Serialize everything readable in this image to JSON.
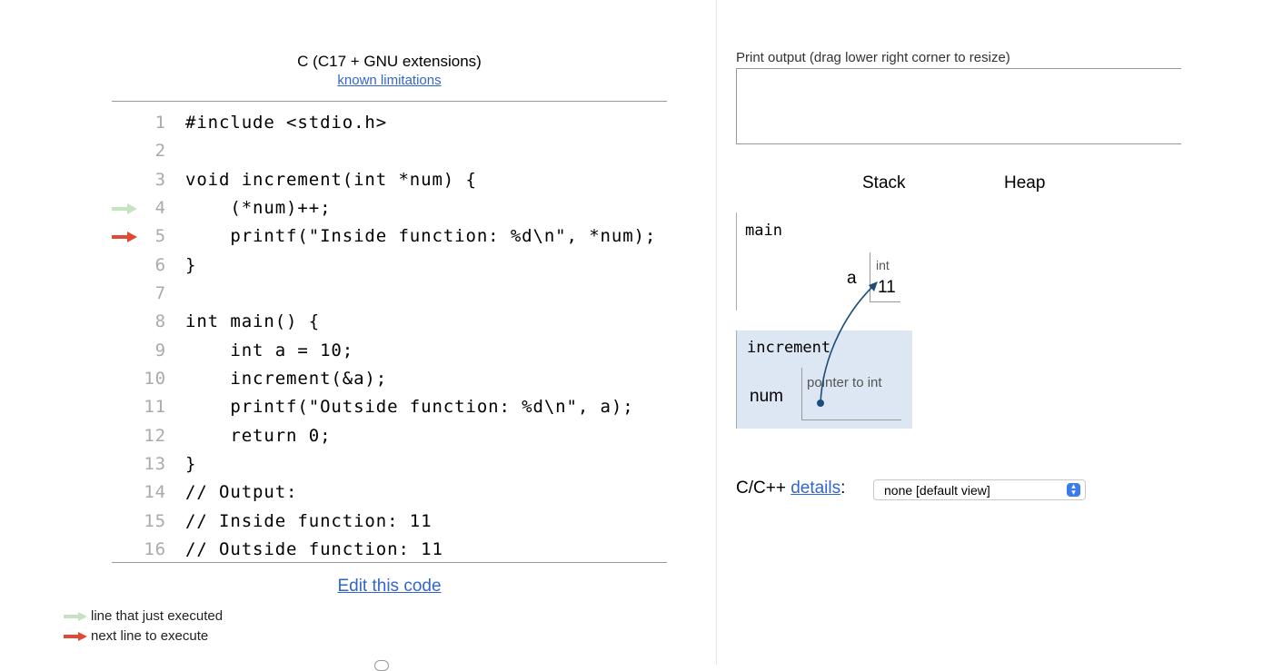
{
  "header": {
    "language": "C (C17 + GNU extensions)",
    "limitations_link": "known limitations"
  },
  "code_lines": [
    {
      "num": "1",
      "text": "#include <stdio.h>",
      "marker": ""
    },
    {
      "num": "2",
      "text": "",
      "marker": ""
    },
    {
      "num": "3",
      "text": "void increment(int *num) {",
      "marker": ""
    },
    {
      "num": "4",
      "text": "    (*num)++;",
      "marker": "just-executed"
    },
    {
      "num": "5",
      "text": "    printf(\"Inside function: %d\\n\", *num);",
      "marker": "next"
    },
    {
      "num": "6",
      "text": "}",
      "marker": ""
    },
    {
      "num": "7",
      "text": "",
      "marker": ""
    },
    {
      "num": "8",
      "text": "int main() {",
      "marker": ""
    },
    {
      "num": "9",
      "text": "    int a = 10;",
      "marker": ""
    },
    {
      "num": "10",
      "text": "    increment(&a);",
      "marker": ""
    },
    {
      "num": "11",
      "text": "    printf(\"Outside function: %d\\n\", a);",
      "marker": ""
    },
    {
      "num": "12",
      "text": "    return 0;",
      "marker": ""
    },
    {
      "num": "13",
      "text": "}",
      "marker": ""
    },
    {
      "num": "14",
      "text": "// Output:",
      "marker": ""
    },
    {
      "num": "15",
      "text": "// Inside function: 11",
      "marker": ""
    },
    {
      "num": "16",
      "text": "// Outside function: 11",
      "marker": ""
    }
  ],
  "edit_link": "Edit this code",
  "legend": {
    "just_executed": "line that just executed",
    "next_line": "next line to execute"
  },
  "colors": {
    "just_executed_arrow": "#c5e3c0",
    "next_arrow": "#e04a35",
    "link": "#3366cc",
    "frame_highlight": "#dde6f3",
    "pointer": "#1d4e7a"
  },
  "print_output": {
    "label": "Print output (drag lower right corner to resize)",
    "content": ""
  },
  "visualizer": {
    "stack_label": "Stack",
    "heap_label": "Heap",
    "frames": [
      {
        "name": "main",
        "var_name": "a",
        "var_type": "int",
        "var_value": "11"
      },
      {
        "name": "increment",
        "var_name": "num",
        "var_type": "pointer to int",
        "var_value": ""
      }
    ]
  },
  "details": {
    "label": "C/C++",
    "link": "details",
    "colon": ":",
    "selected": "none [default view]"
  }
}
